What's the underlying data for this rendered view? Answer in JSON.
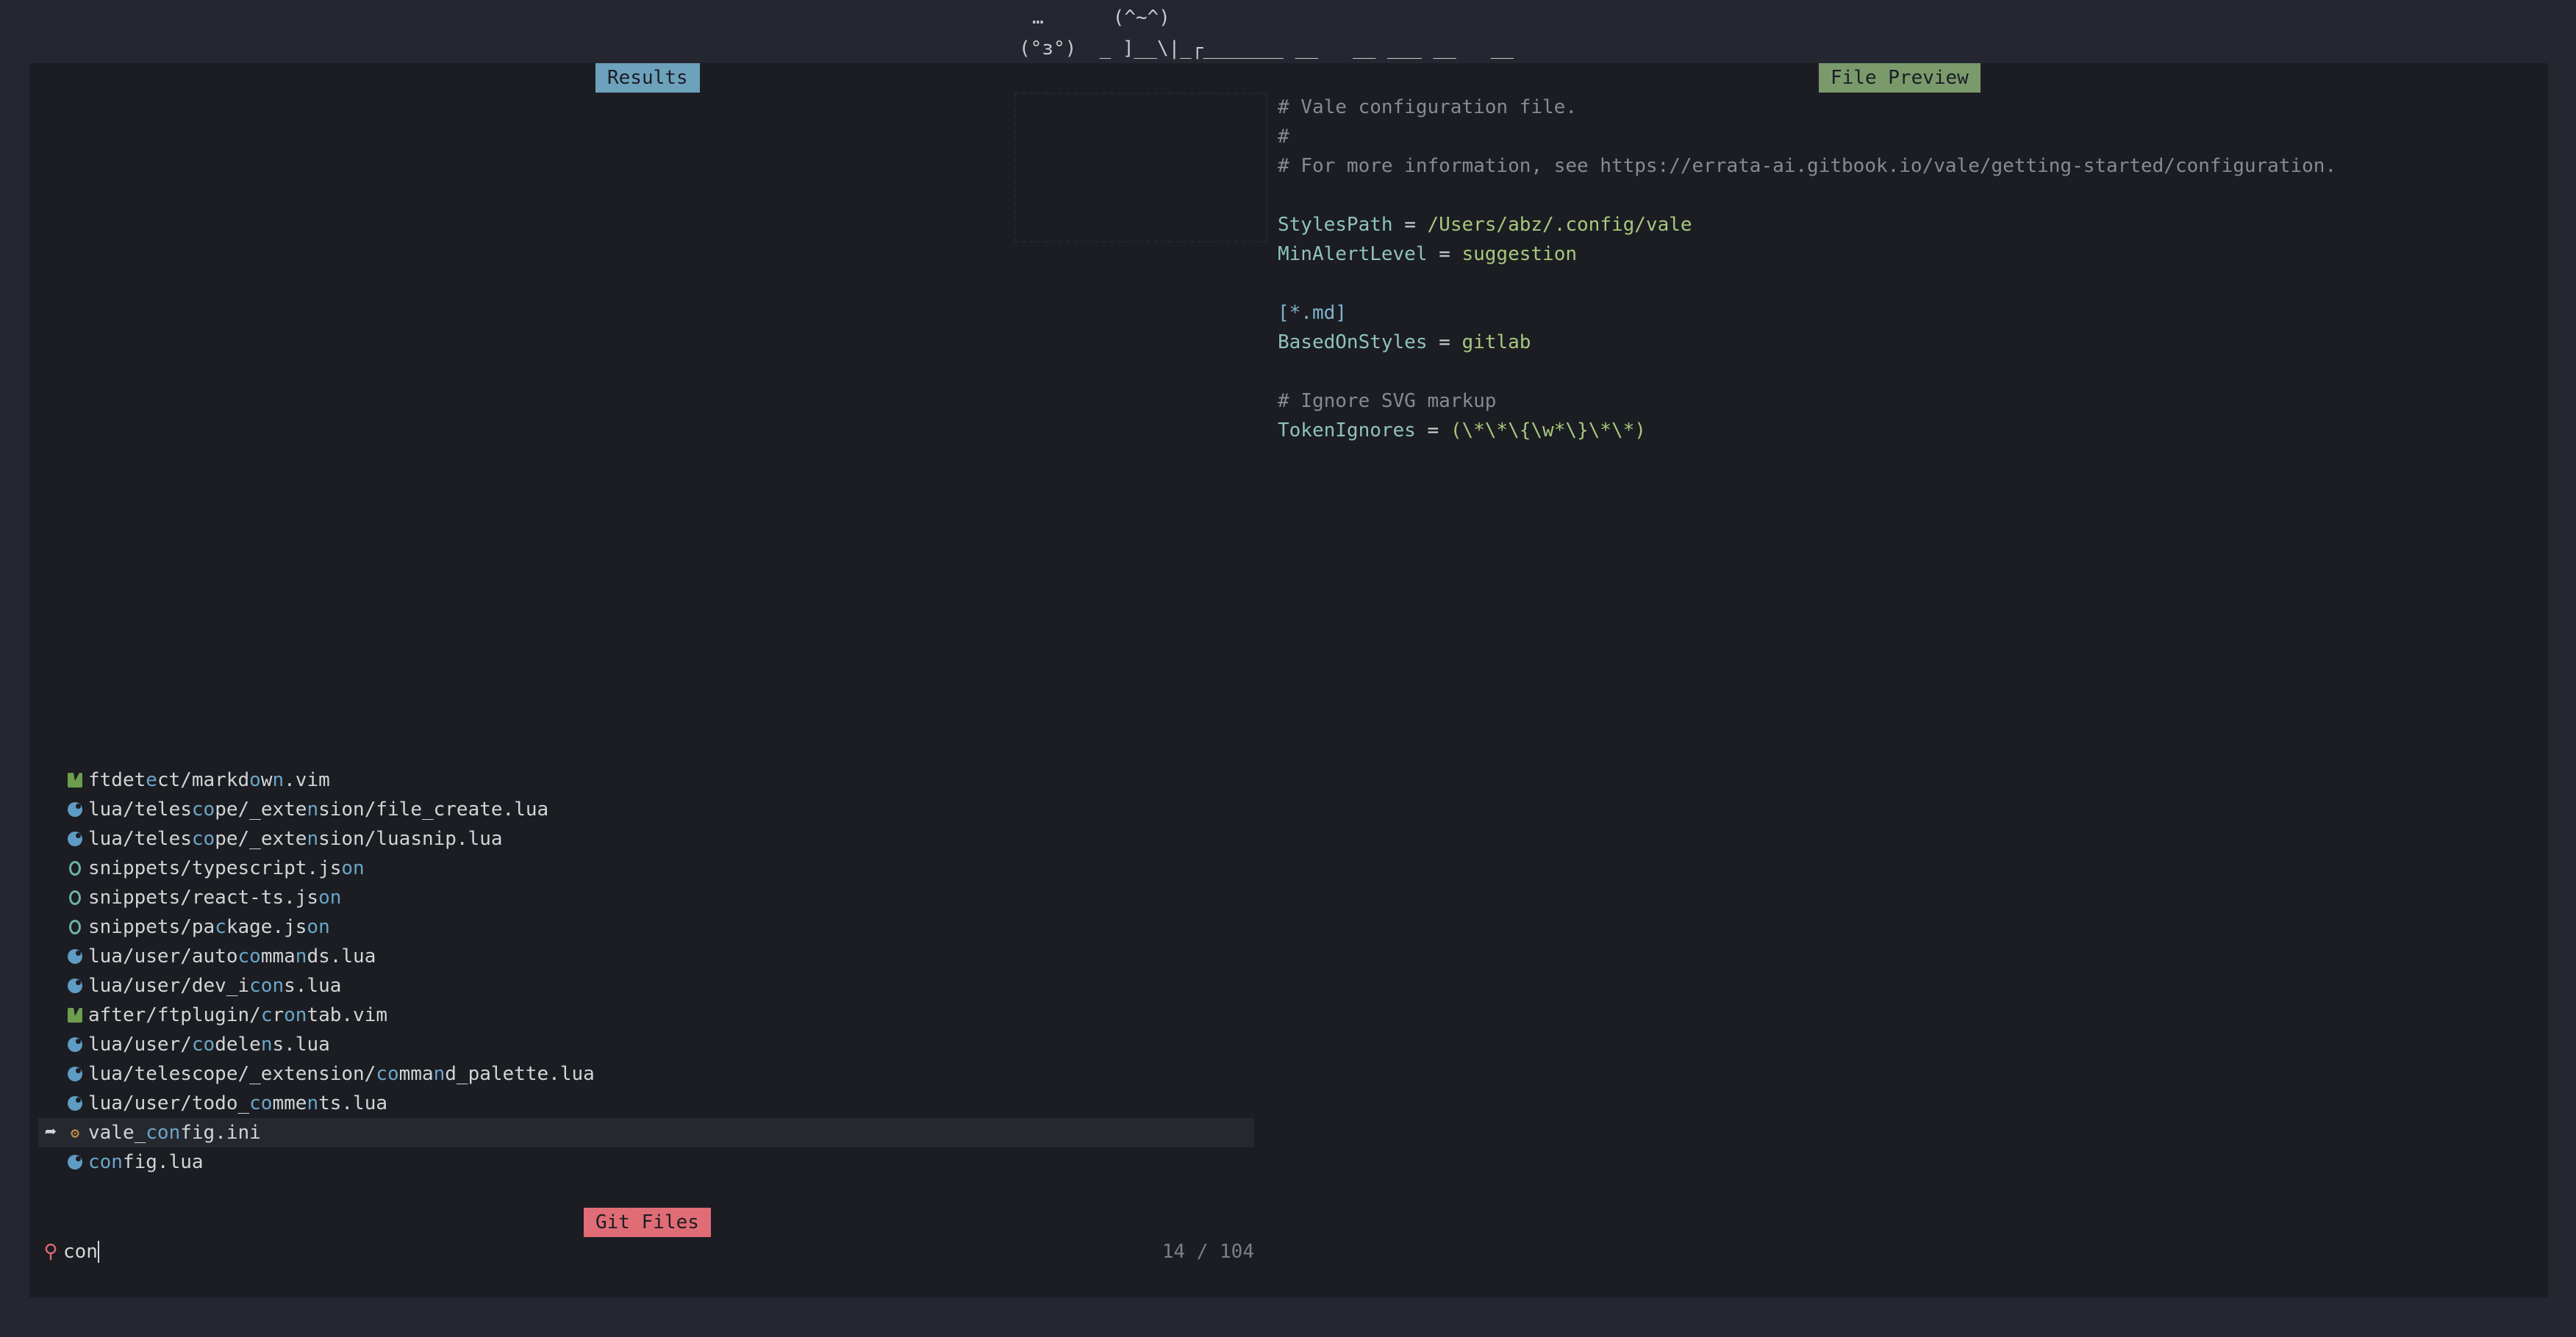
{
  "background_art": {
    "line1": "…      (^~^)",
    "line2": "(°з°)  _ ]__\\|_┌_______ __   __ ___ __   __"
  },
  "results_title": "Results",
  "preview_title": "File Preview",
  "prompt_title": "Git Files",
  "preview_lines": [
    [
      {
        "t": "# Vale configuration file.",
        "c": "comment"
      }
    ],
    [
      {
        "t": "#",
        "c": "comment"
      }
    ],
    [
      {
        "t": "# For more information, see https://errata-ai.gitbook.io/vale/getting-started/configuration.",
        "c": "comment"
      }
    ],
    [],
    [
      {
        "t": "StylesPath",
        "c": "key"
      },
      {
        "t": " = ",
        "c": "ws"
      },
      {
        "t": "/Users/abz/.config/vale",
        "c": "val"
      }
    ],
    [
      {
        "t": "MinAlertLevel",
        "c": "key"
      },
      {
        "t": " = ",
        "c": "ws"
      },
      {
        "t": "suggestion",
        "c": "val"
      }
    ],
    [],
    [
      {
        "t": "[*.md]",
        "c": "sec"
      }
    ],
    [
      {
        "t": "BasedOnStyles",
        "c": "key"
      },
      {
        "t": " = ",
        "c": "ws"
      },
      {
        "t": "gitlab",
        "c": "val"
      }
    ],
    [],
    [
      {
        "t": "# Ignore SVG markup",
        "c": "comment"
      }
    ],
    [
      {
        "t": "TokenIgnores",
        "c": "key"
      },
      {
        "t": " = ",
        "c": "ws"
      },
      {
        "t": "(\\*\\*\\{\\w*\\}\\*\\*)",
        "c": "val"
      }
    ]
  ],
  "results": [
    {
      "icon": "vim",
      "parts": [
        [
          "ftdet",
          0
        ],
        [
          "e",
          1
        ],
        [
          "ct/markd",
          0
        ],
        [
          "o",
          1
        ],
        [
          "w",
          0
        ],
        [
          "n",
          1
        ],
        [
          ".vim",
          0
        ]
      ]
    },
    {
      "icon": "lua",
      "parts": [
        [
          "lua/teles",
          0
        ],
        [
          "co",
          1
        ],
        [
          "pe/_exte",
          0
        ],
        [
          "n",
          1
        ],
        [
          "sion/file_create.lua",
          0
        ]
      ]
    },
    {
      "icon": "lua",
      "parts": [
        [
          "lua/teles",
          0
        ],
        [
          "co",
          1
        ],
        [
          "pe/_exte",
          0
        ],
        [
          "n",
          1
        ],
        [
          "sion/luasnip.lua",
          0
        ]
      ]
    },
    {
      "icon": "json",
      "parts": [
        [
          "snippets/typescript.js",
          0
        ],
        [
          "on",
          1
        ]
      ]
    },
    {
      "icon": "json",
      "parts": [
        [
          "snippets/react-ts.js",
          0
        ],
        [
          "on",
          1
        ]
      ]
    },
    {
      "icon": "json",
      "parts": [
        [
          "snippets/pa",
          0
        ],
        [
          "c",
          1
        ],
        [
          "kage.js",
          0
        ],
        [
          "on",
          1
        ]
      ]
    },
    {
      "icon": "lua",
      "parts": [
        [
          "lua/user/auto",
          0
        ],
        [
          "co",
          1
        ],
        [
          "mma",
          0
        ],
        [
          "n",
          1
        ],
        [
          "ds.lua",
          0
        ]
      ]
    },
    {
      "icon": "lua",
      "parts": [
        [
          "lua/user/dev_i",
          0
        ],
        [
          "con",
          1
        ],
        [
          "s.lua",
          0
        ]
      ]
    },
    {
      "icon": "vim",
      "parts": [
        [
          "after/ftplugin/",
          0
        ],
        [
          "c",
          1
        ],
        [
          "r",
          0
        ],
        [
          "on",
          1
        ],
        [
          "tab.vim",
          0
        ]
      ]
    },
    {
      "icon": "lua",
      "parts": [
        [
          "lua/user/",
          0
        ],
        [
          "co",
          1
        ],
        [
          "dele",
          0
        ],
        [
          "n",
          1
        ],
        [
          "s.lua",
          0
        ]
      ]
    },
    {
      "icon": "lua",
      "parts": [
        [
          "lua/telescope/_extension/",
          0
        ],
        [
          "co",
          1
        ],
        [
          "mma",
          0
        ],
        [
          "n",
          1
        ],
        [
          "d_palette.lua",
          0
        ]
      ]
    },
    {
      "icon": "lua",
      "parts": [
        [
          "lua/user/todo_",
          0
        ],
        [
          "co",
          1
        ],
        [
          "mme",
          0
        ],
        [
          "n",
          1
        ],
        [
          "ts.lua",
          0
        ]
      ]
    },
    {
      "icon": "ini",
      "selected": true,
      "parts": [
        [
          "vale_",
          0
        ],
        [
          "con",
          1
        ],
        [
          "fig.ini",
          0
        ]
      ]
    },
    {
      "icon": "lua",
      "parts": [
        [
          "con",
          1
        ],
        [
          "fig.lua",
          0
        ]
      ]
    }
  ],
  "prompt": {
    "query": "con",
    "counter": "14 / 104"
  },
  "colors": {
    "accent": "#6da2bd",
    "preview": "#7a9a6c",
    "prompt": "#e06c75",
    "match": "#6aa6c9"
  }
}
